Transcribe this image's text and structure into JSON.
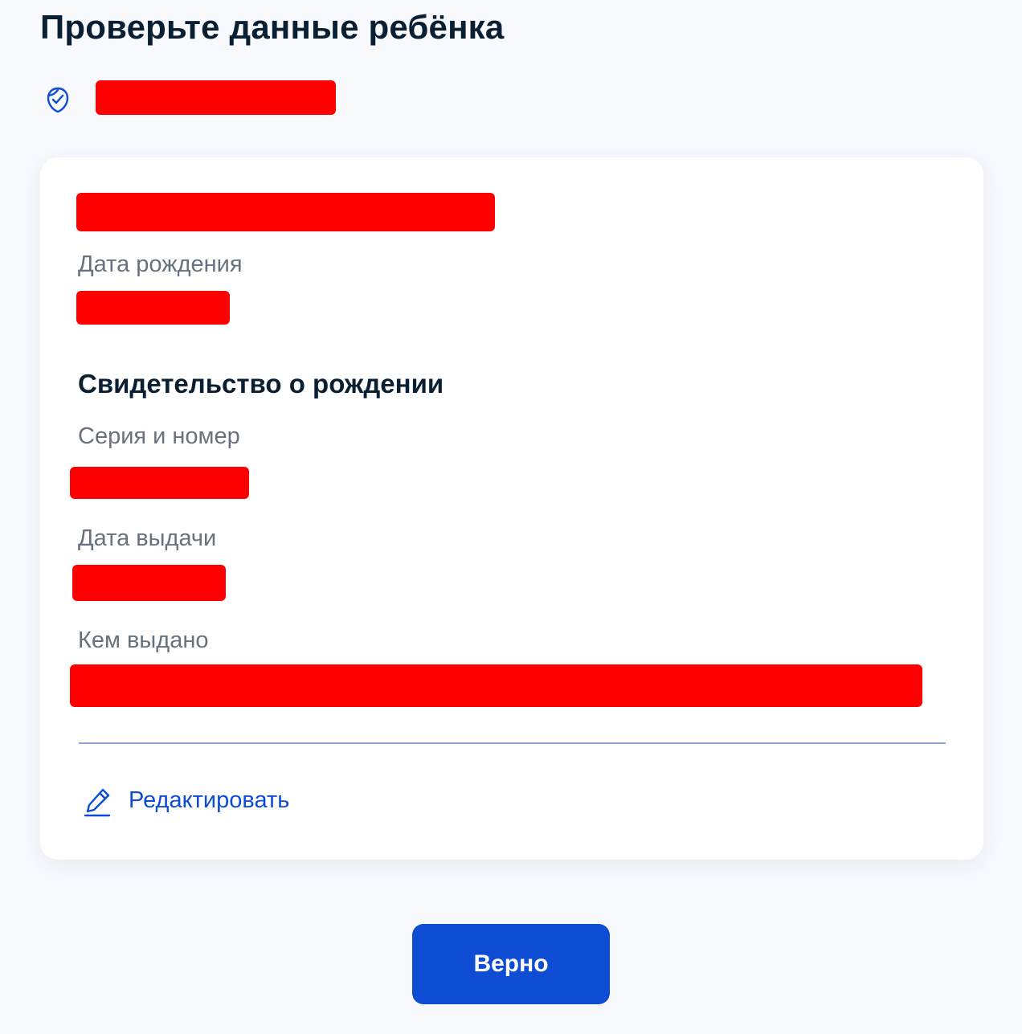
{
  "header": {
    "title": "Проверьте данные ребёнка",
    "verified_icon": "shield-check-icon"
  },
  "card": {
    "birth_date_label": "Дата рождения",
    "certificate_section_title": "Свидетельство о рождении",
    "series_number_label": "Серия и номер",
    "issue_date_label": "Дата выдачи",
    "issued_by_label": "Кем выдано",
    "edit_icon": "pencil-icon",
    "edit_label": "Редактировать"
  },
  "actions": {
    "confirm_label": "Верно"
  },
  "colors": {
    "accent": "#0d4cd3",
    "title_text": "#0b1f33",
    "label_text": "#66727f",
    "redaction": "#ff0000",
    "background": "#f8f9fd",
    "card_background": "#ffffff"
  }
}
